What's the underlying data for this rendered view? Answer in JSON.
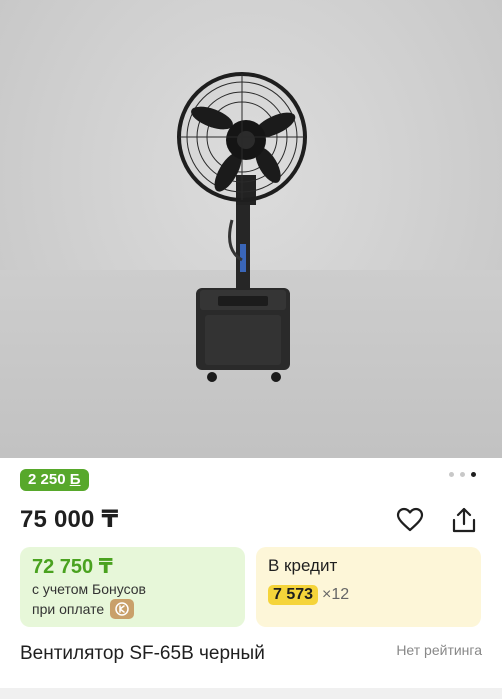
{
  "product": {
    "image_alt": "",
    "bonus_badge": "2 250 ",
    "bonus_currency": "Б",
    "price": "75 000 ₸",
    "title": "Вентилятор SF-65B черный",
    "rating_text": "Нет рейтинга"
  },
  "gallery": {
    "dot_count": 3,
    "active_index": 2
  },
  "bonus_card": {
    "value": "72 750 ₸",
    "line1": "с учетом Бонусов",
    "line2": "при оплате"
  },
  "credit_card": {
    "title": "В кредит",
    "monthly": "7 573",
    "months": "×12"
  },
  "colors": {
    "bonus_green": "#57a82b",
    "credit_yellow": "#f5d43a"
  },
  "icons": {
    "favorite": "heart-icon",
    "share": "share-icon",
    "payment": "kaspi-pay-icon"
  }
}
